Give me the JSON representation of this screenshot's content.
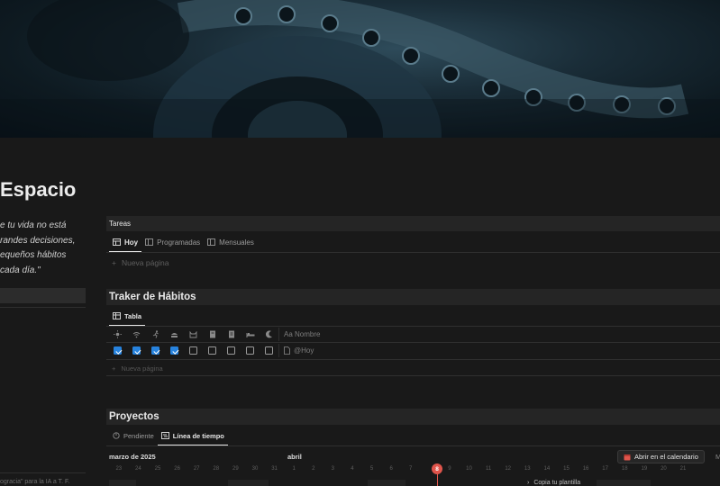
{
  "page": {
    "title": "Espacio",
    "quote": [
      "e tu vida no está",
      "randes decisiones,",
      "equeños hábitos",
      "cada día.\""
    ],
    "footer_text": "ogracia\" para la IA a T. F."
  },
  "tareas": {
    "title": "Tareas",
    "tabs": [
      {
        "label": "Hoy",
        "icon": "table-icon",
        "active": true
      },
      {
        "label": "Programadas",
        "icon": "table-icon",
        "active": false
      },
      {
        "label": "Mensuales",
        "icon": "table-icon",
        "active": false
      }
    ],
    "new_page": "Nueva página"
  },
  "habitos": {
    "title": "Traker de Hábitos",
    "view": "Tabla",
    "columns": [
      "sun-icon",
      "wifi-icon",
      "run-icon",
      "lunch-icon",
      "cat-icon",
      "book-icon",
      "doc-icon",
      "bed-icon",
      "moon-icon"
    ],
    "name_header": "Aa Nombre",
    "row": {
      "checks": [
        true,
        true,
        true,
        true,
        false,
        false,
        false,
        false,
        false
      ],
      "name": "@Hoy"
    },
    "new_page": "Nueva página"
  },
  "proyectos": {
    "title": "Proyectos",
    "tabs": [
      {
        "label": "Pendiente",
        "icon": "circle-icon",
        "active": false
      },
      {
        "label": "Línea de tiempo",
        "icon": "timeline-icon",
        "active": true
      }
    ],
    "months": [
      "marzo de 2025",
      "abril"
    ],
    "calendar_button": "Abrir en el calendario",
    "overflow_letter": "M",
    "days": [
      "23",
      "24",
      "25",
      "26",
      "27",
      "28",
      "29",
      "30",
      "31",
      "1",
      "2",
      "3",
      "4",
      "5",
      "6",
      "7",
      "8",
      "9",
      "10",
      "11",
      "12",
      "13",
      "14",
      "15",
      "16",
      "17",
      "18",
      "19",
      "20",
      "21",
      "22"
    ],
    "today": "8",
    "bottom_text": "Copia tu plantilla",
    "accent": "#e0554c"
  }
}
